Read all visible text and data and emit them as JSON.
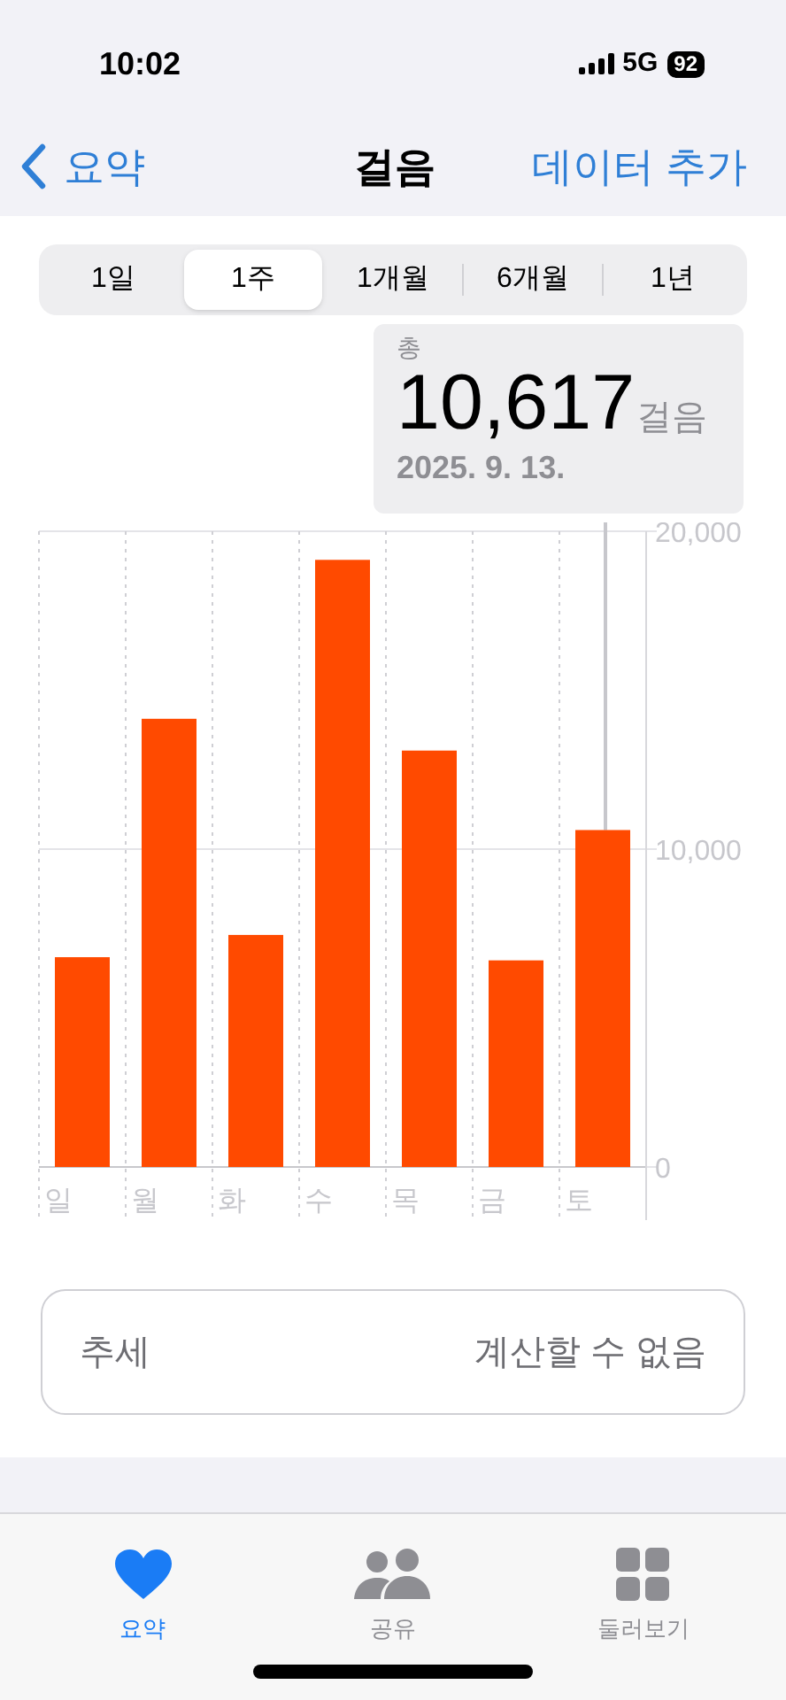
{
  "status_bar": {
    "time": "10:02",
    "network": "5G",
    "battery": "92"
  },
  "nav": {
    "back": "요약",
    "title": "걸음",
    "action": "데이터 추가"
  },
  "ranges": [
    {
      "label": "1일",
      "selected": false
    },
    {
      "label": "1주",
      "selected": true
    },
    {
      "label": "1개월",
      "selected": false
    },
    {
      "label": "6개월",
      "selected": false
    },
    {
      "label": "1년",
      "selected": false
    }
  ],
  "callout": {
    "label": "총",
    "value": "10,617",
    "unit": "걸음",
    "date": "2025. 9. 13."
  },
  "chart_data": {
    "type": "bar",
    "categories": [
      "일",
      "월",
      "화",
      "수",
      "목",
      "금",
      "토"
    ],
    "series": [
      {
        "color": "#ff4a00",
        "values": [
          6600,
          14100,
          7300,
          19100,
          13100,
          6500,
          10600
        ]
      }
    ],
    "ylim": [
      0,
      20000
    ],
    "yticks": [
      {
        "value": 0,
        "label": "0"
      },
      {
        "value": 10000,
        "label": "10,000"
      },
      {
        "value": 20000,
        "label": "20,000"
      }
    ]
  },
  "trend": {
    "label": "추세",
    "value": "계산할 수 없음"
  },
  "tab_bar": [
    {
      "label": "요약",
      "kind": "heart",
      "selected": true
    },
    {
      "label": "공유",
      "kind": "people",
      "selected": false
    },
    {
      "label": "둘러보기",
      "kind": "grid",
      "selected": false
    }
  ]
}
